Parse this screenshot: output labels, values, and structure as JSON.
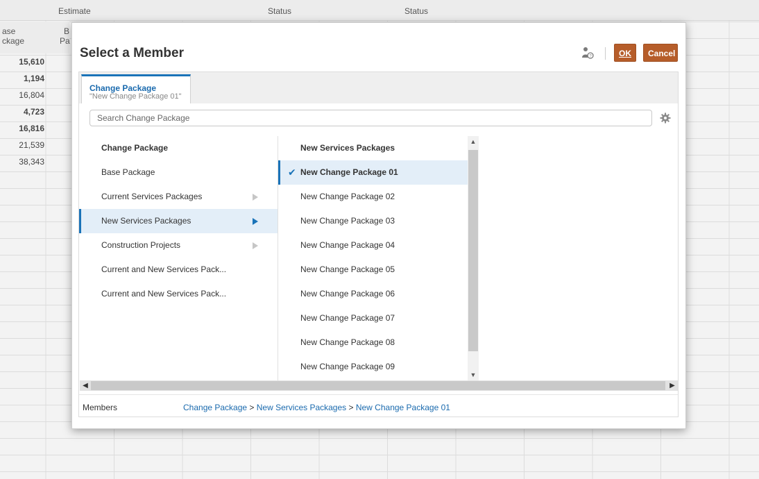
{
  "background": {
    "headers": [
      "Estimate",
      "Status",
      "Status"
    ],
    "col_header_a": "ase",
    "col_header_a2": "ckage",
    "col_header_b": "B",
    "col_header_b2": "Pa",
    "values": [
      "15,610",
      "1,194",
      "16,804",
      "4,723",
      "16,816",
      "21,539",
      "38,343"
    ]
  },
  "dialog": {
    "title": "Select a Member",
    "ok_label": "OK",
    "cancel_label": "Cancel",
    "tab": {
      "title": "Change Package",
      "subtitle": "\"New Change Package 01\""
    },
    "search_placeholder": "Search Change Package",
    "left_column": {
      "header": "Change Package",
      "items": [
        {
          "label": "Base Package",
          "has_children": false
        },
        {
          "label": "Current Services Packages",
          "has_children": true
        },
        {
          "label": "New Services Packages",
          "has_children": true,
          "selected": true
        },
        {
          "label": "Construction Projects",
          "has_children": true
        },
        {
          "label": "Current and New Services Pack...",
          "has_children": false
        },
        {
          "label": "Current and New Services Pack...",
          "has_children": false
        }
      ]
    },
    "mid_column": {
      "header": "New Services Packages",
      "items": [
        "New Change Package 01",
        "New Change Package 02",
        "New Change Package 03",
        "New Change Package 04",
        "New Change Package 05",
        "New Change Package 06",
        "New Change Package 07",
        "New Change Package 08",
        "New Change Package 09"
      ],
      "selected": "New Change Package 01"
    },
    "footer": {
      "label": "Members",
      "crumb_1": "Change Package",
      "crumb_2": "New Services Packages",
      "crumb_3": "New Change Package 01",
      "separator": " > "
    }
  },
  "colors": {
    "accent": "#1a73b8",
    "button": "#b65d2a"
  }
}
